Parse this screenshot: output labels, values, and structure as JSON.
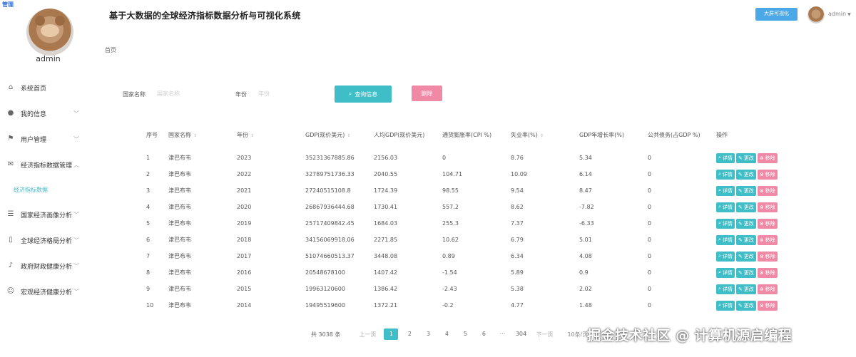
{
  "corner_logo": "管理",
  "sidebar": {
    "username": "admin",
    "items": [
      {
        "label": "系统首页",
        "icon": "home-icon",
        "glyph": "⌂",
        "has_chevron": false
      },
      {
        "label": "我的信息",
        "icon": "user-icon",
        "glyph": "●",
        "has_chevron": true,
        "chevron": "﹀"
      },
      {
        "label": "用户管理",
        "icon": "flag-icon",
        "glyph": "⚑",
        "has_chevron": true,
        "chevron": "﹀"
      },
      {
        "label": "经济指标数据管理",
        "icon": "mail-icon",
        "glyph": "✉",
        "has_chevron": true,
        "chevron": "︿"
      },
      {
        "label": "国家经济画像分析",
        "icon": "sliders-icon",
        "glyph": "☰",
        "has_chevron": true,
        "chevron": "﹀"
      },
      {
        "label": "全球经济格局分析",
        "icon": "phone-icon",
        "glyph": "▯",
        "has_chevron": true,
        "chevron": "﹀"
      },
      {
        "label": "政府财政健康分析",
        "icon": "microphone-icon",
        "glyph": "♪",
        "has_chevron": true,
        "chevron": "﹀"
      },
      {
        "label": "宏观经济健康分析",
        "icon": "smile-icon",
        "glyph": "☺",
        "has_chevron": true,
        "chevron": "﹀"
      }
    ],
    "submenu_label": "经济指标数据"
  },
  "header": {
    "title": "基于大数据的全球经济指标数据分析与可视化系统",
    "big_screen_button": "大屏可视化",
    "username": "admin",
    "caret": "▼"
  },
  "breadcrumb": "首页",
  "search": {
    "country_label": "国家名称",
    "country_placeholder": "国家名称",
    "year_label": "年份",
    "year_placeholder": "年份",
    "query_button": "查询信息",
    "delete_button": "删除",
    "query_icon": "⌕"
  },
  "table": {
    "columns": [
      "序号",
      "国家名称",
      "年份",
      "GDP(现价美元)",
      "人均GDP(现价美元)",
      "通货膨胀率(CPI %)",
      "失业率(%)",
      "GDP年增长率(%)",
      "公共债务(占GDP %)",
      "操作"
    ],
    "sort_glyph": "⇕",
    "op_labels": {
      "detail": "详情",
      "edit": "更改",
      "remove": "移除"
    },
    "op_icons": {
      "detail": "⌕",
      "edit": "✎",
      "remove": "⊗"
    },
    "rows": [
      [
        "1",
        "津巴布韦",
        "2023",
        "35231367885.86",
        "2156.03",
        "0",
        "8.76",
        "5.34",
        "0"
      ],
      [
        "2",
        "津巴布韦",
        "2022",
        "32789751736.33",
        "2040.55",
        "104.71",
        "10.09",
        "6.14",
        "0"
      ],
      [
        "3",
        "津巴布韦",
        "2021",
        "27240515108.8",
        "1724.39",
        "98.55",
        "9.54",
        "8.47",
        "0"
      ],
      [
        "4",
        "津巴布韦",
        "2020",
        "26867936444.68",
        "1730.41",
        "557.2",
        "8.62",
        "-7.82",
        "0"
      ],
      [
        "5",
        "津巴布韦",
        "2019",
        "25717409842.45",
        "1684.03",
        "255.3",
        "7.37",
        "-6.33",
        "0"
      ],
      [
        "6",
        "津巴布韦",
        "2018",
        "34156069918.06",
        "2271.85",
        "10.62",
        "6.79",
        "5.01",
        "0"
      ],
      [
        "7",
        "津巴布韦",
        "2017",
        "51074660513.37",
        "3448.08",
        "0.89",
        "6.34",
        "4.08",
        "0"
      ],
      [
        "8",
        "津巴布韦",
        "2016",
        "20548678100",
        "1407.42",
        "-1.54",
        "5.89",
        "0.9",
        "0"
      ],
      [
        "9",
        "津巴布韦",
        "2015",
        "19963120600",
        "1386.42",
        "-2.43",
        "5.38",
        "2.02",
        "0"
      ],
      [
        "10",
        "津巴布韦",
        "2014",
        "19495519600",
        "1372.21",
        "-0.2",
        "4.77",
        "1.48",
        "0"
      ]
    ]
  },
  "pagination": {
    "total": "共 3038 条",
    "prev": "上一页",
    "pages": [
      "1",
      "2",
      "3",
      "4",
      "5",
      "6",
      "···",
      "304"
    ],
    "active": "1",
    "next": "下一页",
    "page_size": "10条/页"
  },
  "watermark": "掘金技术社区 @ 计算机源启编程",
  "colors": {
    "accent": "#3fbec7",
    "danger": "#f089a5",
    "big_screen": "#4aa9e6",
    "submenu_active": "#4fb7c7"
  }
}
